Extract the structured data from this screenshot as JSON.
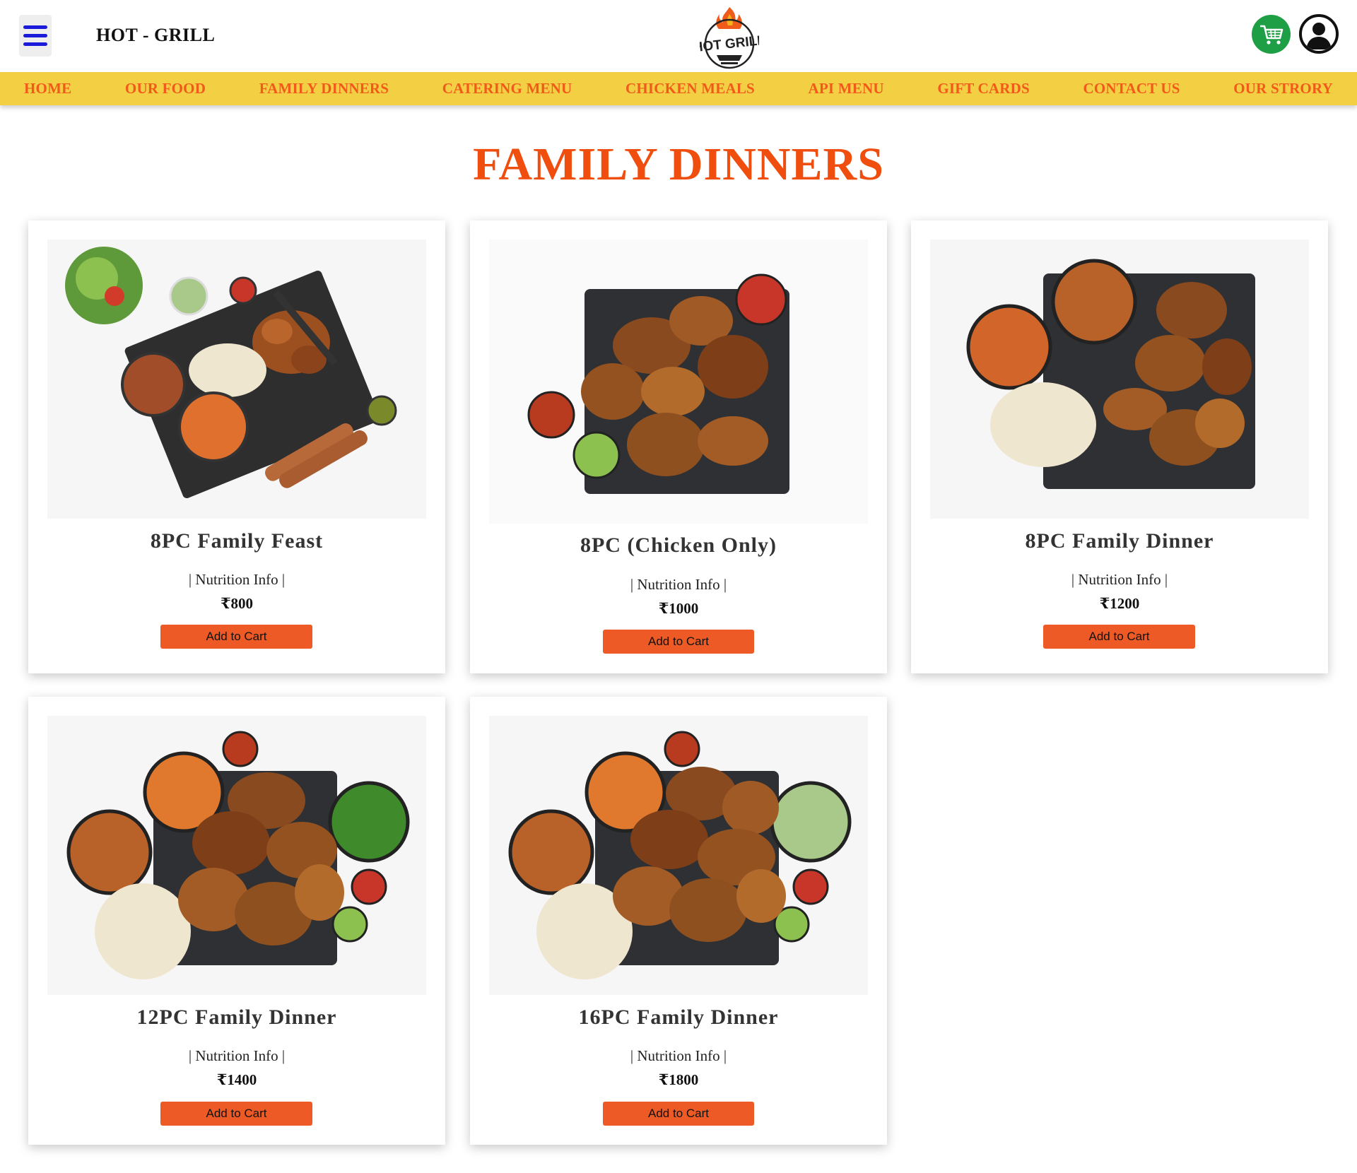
{
  "header": {
    "brand": "HOT - GRILL",
    "logo_text": "HOT GRILL",
    "menu_icon": "hamburger-menu-icon",
    "cart_icon": "shopping-cart-icon",
    "user_icon": "user-account-icon",
    "cart_color": "#1e9e45",
    "menu_color": "#1a1adb"
  },
  "nav": {
    "background": "#f3cf44",
    "link_color": "#f25a1a",
    "items": [
      {
        "label": "HOME"
      },
      {
        "label": "OUR FOOD"
      },
      {
        "label": "FAMILY DINNERS"
      },
      {
        "label": "CATERING MENU"
      },
      {
        "label": "CHICKEN MEALS"
      },
      {
        "label": "API MENU"
      },
      {
        "label": "GIFT CARDS"
      },
      {
        "label": "CONTACT US"
      },
      {
        "label": "OUR STRORY"
      }
    ]
  },
  "page": {
    "title": "FAMILY DINNERS",
    "title_color": "#f04e0f"
  },
  "products": [
    {
      "name": "8PC Family Feast",
      "nutrition": "| Nutrition Info |",
      "price": "₹800",
      "button": "Add to Cart"
    },
    {
      "name": "8PC (Chicken Only)",
      "nutrition": "| Nutrition Info |",
      "price": "₹1000",
      "button": "Add to Cart"
    },
    {
      "name": "8PC Family Dinner",
      "nutrition": "| Nutrition Info |",
      "price": "₹1200",
      "button": "Add to Cart"
    },
    {
      "name": "12PC Family Dinner",
      "nutrition": "| Nutrition Info |",
      "price": "₹1400",
      "button": "Add to Cart"
    },
    {
      "name": "16PC Family Dinner",
      "nutrition": "| Nutrition Info |",
      "price": "₹1800",
      "button": "Add to Cart"
    }
  ],
  "button_color": "#ee5a25"
}
